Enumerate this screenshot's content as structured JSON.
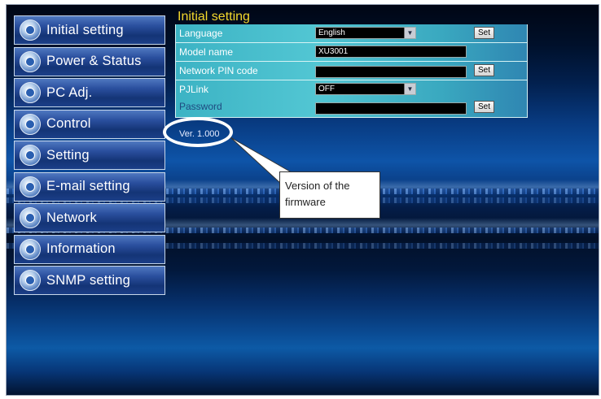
{
  "sidebar": {
    "items": [
      {
        "label": "Initial setting",
        "icon": "globe-icon"
      },
      {
        "label": "Power & Status",
        "icon": "power-icon"
      },
      {
        "label": "PC Adj.",
        "icon": "monitor-icon"
      },
      {
        "label": "Control",
        "icon": "control-icon"
      },
      {
        "label": "Setting",
        "icon": "wrench-icon"
      },
      {
        "label": "E-mail setting",
        "icon": "mail-icon"
      },
      {
        "label": "Network",
        "icon": "network-icon"
      },
      {
        "label": "Information",
        "icon": "info-icon"
      },
      {
        "label": "SNMP setting",
        "icon": "snmp-icon"
      }
    ]
  },
  "panel": {
    "title": "Initial setting",
    "language": {
      "label": "Language",
      "value": "English",
      "button": "Set"
    },
    "model_name": {
      "label": "Model name",
      "value": "XU3001"
    },
    "pin_code": {
      "label": "Network PIN code",
      "value": "",
      "button": "Set"
    },
    "pjlink": {
      "label": "PJLink",
      "value": "OFF"
    },
    "password": {
      "label": "Password",
      "value": "",
      "button": "Set"
    },
    "version": "Ver. 1.000"
  },
  "annotation": {
    "line1": "Version of the",
    "line2": "firmware"
  },
  "colors": {
    "title_yellow": "#f4d82c",
    "panel_cyan": "#3cb3c4"
  }
}
